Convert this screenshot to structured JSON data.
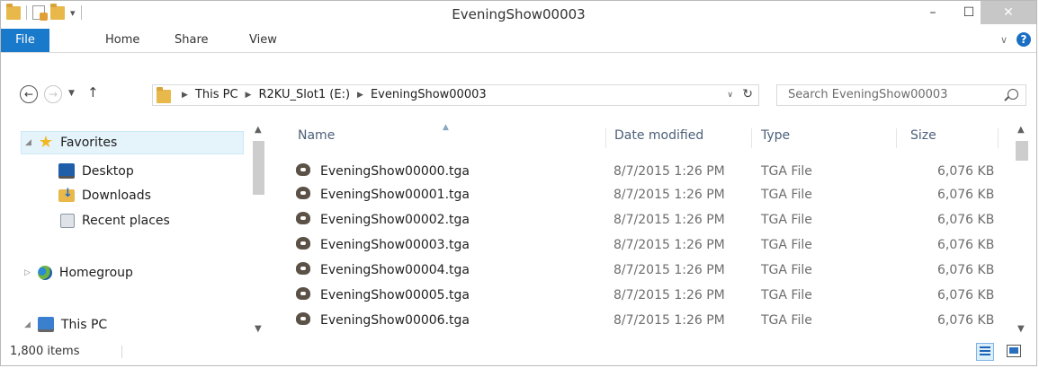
{
  "window": {
    "title": "EveningShow00003",
    "minimize": "–",
    "maximize": "☐",
    "close": "✕"
  },
  "ribbon": {
    "tabs": [
      "File",
      "Home",
      "Share",
      "View"
    ],
    "help": "?"
  },
  "nav": {
    "back": "←",
    "forward": "→",
    "up": "↑",
    "breadcrumb": [
      "This PC",
      "R2KU_Slot1 (E:)",
      "EveningShow00003"
    ],
    "search_placeholder": "Search EveningShow00003"
  },
  "sidebar": {
    "favorites": "Favorites",
    "items": [
      "Desktop",
      "Downloads",
      "Recent places"
    ],
    "homegroup": "Homegroup",
    "thispc": "This PC"
  },
  "list": {
    "columns": [
      "Name",
      "Date modified",
      "Type",
      "Size"
    ],
    "rows": [
      {
        "name": "EveningShow00000.tga",
        "date": "8/7/2015 1:26 PM",
        "type": "TGA File",
        "size": "6,076 KB"
      },
      {
        "name": "EveningShow00001.tga",
        "date": "8/7/2015 1:26 PM",
        "type": "TGA File",
        "size": "6,076 KB"
      },
      {
        "name": "EveningShow00002.tga",
        "date": "8/7/2015 1:26 PM",
        "type": "TGA File",
        "size": "6,076 KB"
      },
      {
        "name": "EveningShow00003.tga",
        "date": "8/7/2015 1:26 PM",
        "type": "TGA File",
        "size": "6,076 KB"
      },
      {
        "name": "EveningShow00004.tga",
        "date": "8/7/2015 1:26 PM",
        "type": "TGA File",
        "size": "6,076 KB"
      },
      {
        "name": "EveningShow00005.tga",
        "date": "8/7/2015 1:26 PM",
        "type": "TGA File",
        "size": "6,076 KB"
      },
      {
        "name": "EveningShow00006.tga",
        "date": "8/7/2015 1:26 PM",
        "type": "TGA File",
        "size": "6,076 KB"
      }
    ]
  },
  "status": {
    "item_count": "1,800 items"
  }
}
